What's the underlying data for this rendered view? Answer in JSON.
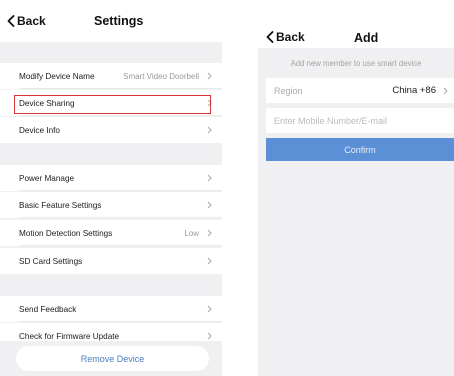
{
  "settings": {
    "back_label": "Back",
    "title": "Settings",
    "rows": {
      "modify_name": {
        "label": "Modify Device Name",
        "value": "Smart  Video Doorbell"
      },
      "device_sharing": {
        "label": "Device Sharing"
      },
      "device_info": {
        "label": "Device Info"
      },
      "power": {
        "label": "Power Manage"
      },
      "basic": {
        "label": "Basic Feature Settings"
      },
      "motion": {
        "label": "Motion Detection Settings",
        "value": "Low"
      },
      "sd": {
        "label": "SD Card Settings"
      },
      "feedback": {
        "label": "Send Feedback"
      },
      "firmware": {
        "label": "Check for Firmware Update"
      }
    },
    "remove_label": "Remove Device",
    "highlight_color": "#d9343a"
  },
  "add": {
    "back_label": "Back",
    "title": "Add",
    "hint": "Add new member to use smart device",
    "region_label": "Region",
    "region_value": "China +86",
    "phone_placeholder": "Enter Mobile Number/E-mail",
    "confirm_label": "Confirm",
    "confirm_color": "#5b8fd6"
  },
  "icons": {
    "back": "chevron-left-icon",
    "row_arrow": "chevron-right-icon"
  }
}
